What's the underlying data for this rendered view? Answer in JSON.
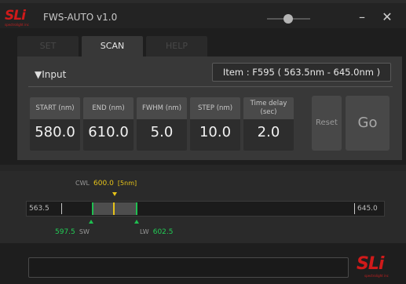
{
  "app": {
    "logo_text": "SLi",
    "logo_subtext": "spectrolight inc",
    "title": "FWS-AUTO v1.0",
    "minimize_symbol": "–",
    "close_symbol": "✕"
  },
  "tabs": [
    {
      "label": "SET",
      "active": false
    },
    {
      "label": "SCAN",
      "active": true
    },
    {
      "label": "HELP",
      "active": false
    }
  ],
  "input_section": {
    "label": "▼Input",
    "item": "Item : F595 ( 563.5nm - 645.0nm )"
  },
  "params": [
    {
      "header": "START (nm)",
      "value": "580.0"
    },
    {
      "header": "END (nm)",
      "value": "610.0"
    },
    {
      "header": "FWHM (nm)",
      "value": "5.0"
    },
    {
      "header": "STEP (nm)",
      "value": "10.0"
    },
    {
      "header": "Time delay\n(sec)",
      "value": "2.0"
    }
  ],
  "buttons": {
    "reset": "Reset",
    "go": "Go"
  },
  "scan_bar": {
    "cwl_label": "CWL",
    "cwl_value": "600.0",
    "cwl_unit": "[5nm]",
    "min": "563.5",
    "max": "645.0",
    "sw_value": "597.5",
    "sw_label": "SW",
    "lw_label": "LW",
    "lw_value": "602.5"
  },
  "colors": {
    "cwl": "#e6c319",
    "sw_lw": "#22cc55",
    "brand": "#d01a1a"
  }
}
